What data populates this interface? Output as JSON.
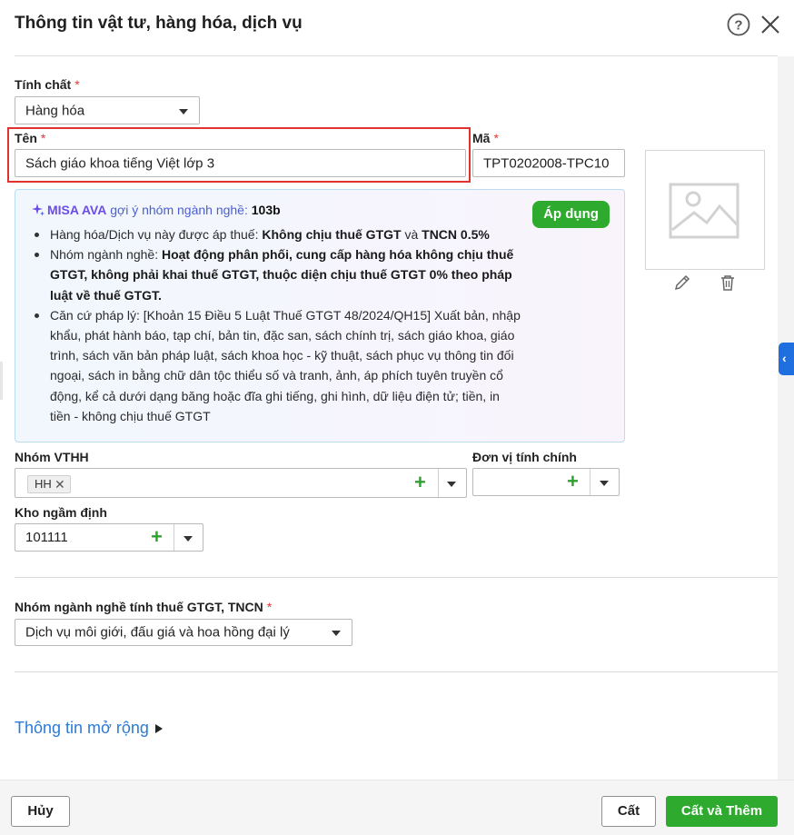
{
  "header": {
    "title": "Thông tin vật tư, hàng hóa, dịch vụ",
    "help_icon": "question-circle-icon",
    "close_icon": "close-x-icon"
  },
  "form": {
    "tinh_chat": {
      "label": "Tính chất",
      "required_mark": "*",
      "value": "Hàng hóa"
    },
    "ten": {
      "label": "Tên",
      "required_mark": "*",
      "value": "Sách giáo khoa tiếng Việt lớp 3"
    },
    "ma": {
      "label": "Mã",
      "required_mark": "*",
      "value": "TPT0202008-TPC10"
    },
    "image": {
      "placeholder_icon": "image-placeholder-icon",
      "edit_icon": "pencil-icon",
      "delete_icon": "trash-icon"
    },
    "nhom_vthh": {
      "label": "Nhóm VTHH",
      "tag": "HH",
      "tag_remove": "✕",
      "add": "+"
    },
    "don_vi_tinh": {
      "label": "Đơn vị tính chính",
      "value": "",
      "add": "+"
    },
    "kho": {
      "label": "Kho ngầm định",
      "value": "101111",
      "add": "+"
    },
    "nhom_nganh_nghe": {
      "label": "Nhóm ngành nghề tính thuế GTGT, TNCN",
      "required_mark": "*",
      "value": "Dịch vụ môi giới, đấu giá và hoa hồng đại lý"
    }
  },
  "ai_suggestion": {
    "icon": "sparkle-icon",
    "brand": "MISA AVA",
    "subtitle": " gợi ý nhóm ngành nghề: ",
    "code": "103b",
    "apply_label": "Áp dụng",
    "item1_prefix": "Hàng hóa/Dịch vụ này được áp thuế: ",
    "item1_bold1": "Không chịu thuế GTGT",
    "item1_mid": " và ",
    "item1_bold2": "TNCN 0.5%",
    "item2_prefix": "Nhóm ngành nghề: ",
    "item2_bold": "Hoạt động phân phối, cung cấp hàng hóa không chịu thuế GTGT, không phải khai thuế GTGT, thuộc diện chịu thuế GTGT 0% theo pháp luật về thuế GTGT.",
    "item3": "Căn cứ pháp lý: [Khoản 15 Điều 5 Luật Thuế GTGT 48/2024/QH15] Xuất bản, nhập khẩu, phát hành báo, tạp chí, bản tin, đặc san, sách chính trị, sách giáo khoa, giáo trình, sách văn bản pháp luật, sách khoa học - kỹ thuật, sách phục vụ thông tin đối ngoại, sách in bằng chữ dân tộc thiểu số và tranh, ảnh, áp phích tuyên truyền cổ động, kể cả dưới dạng băng hoặc đĩa ghi tiếng, ghi hình, dữ liệu điện tử; tiền, in tiền - không chịu thuế GTGT"
  },
  "extended": {
    "label": "Thông tin mở rộng"
  },
  "footer": {
    "cancel_label": "Hủy",
    "save_label": "Cất",
    "save_add_label": "Cất và Thêm"
  },
  "colors": {
    "accent_green": "#2eab2e",
    "link_blue": "#2b7bd6",
    "highlight_red": "#e0332f",
    "ai_purple": "#6b4de6",
    "side_tab_blue": "#1f6fe0"
  }
}
